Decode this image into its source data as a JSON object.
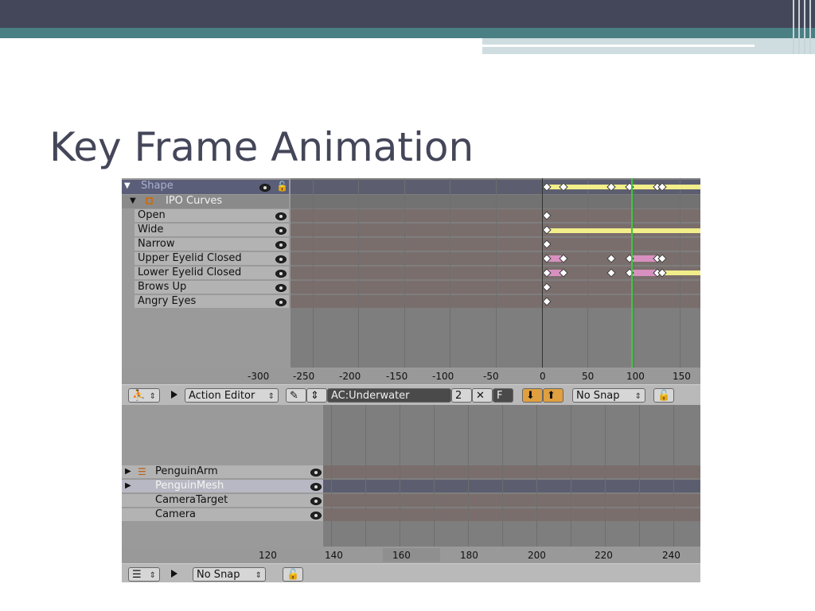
{
  "slide": {
    "title": "Key Frame Animation"
  },
  "action_editor": {
    "shape_header": "Shape",
    "ipo_curves_label": "IPO Curves",
    "channels": [
      {
        "label": "Open"
      },
      {
        "label": "Wide"
      },
      {
        "label": "Narrow"
      },
      {
        "label": "Upper Eyelid Closed"
      },
      {
        "label": "Lower Eyelid Closed"
      },
      {
        "label": "Brows Up"
      },
      {
        "label": "Angry Eyes"
      }
    ],
    "frame_ticks": [
      "-300",
      "-250",
      "-200",
      "-150",
      "-100",
      "-50",
      "0",
      "50",
      "100",
      "150"
    ],
    "current_frame": 100,
    "header": {
      "editor_type": "Action Editor",
      "action_name": "AC:Underwater",
      "users_count": "2",
      "close_label": "✕",
      "fake_user_label": "F",
      "snap_mode": "No Snap"
    }
  },
  "nla_editor": {
    "objects": [
      {
        "label": "PenguinArm"
      },
      {
        "label": "PenguinMesh"
      },
      {
        "label": "CameraTarget"
      },
      {
        "label": "Camera"
      }
    ],
    "frame_ticks": [
      "120",
      "140",
      "160",
      "180",
      "200",
      "220",
      "240"
    ],
    "header": {
      "snap_mode": "No Snap"
    }
  },
  "colors": {
    "slide_title": "#444659",
    "top_bar": "#444659",
    "teal_bar": "#4a7f83",
    "key_yellow": "#f2ee8a",
    "key_pink": "#d890c0",
    "current_frame_line": "#3cc83c"
  }
}
